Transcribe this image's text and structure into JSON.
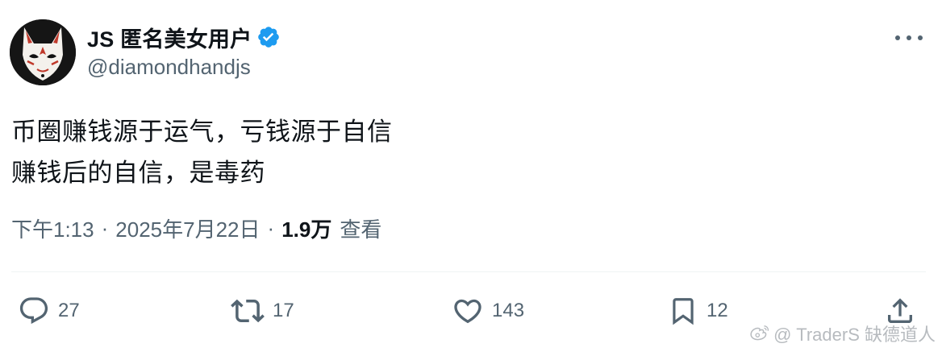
{
  "author": {
    "display_name": "JS 匿名美女用户",
    "handle": "@diamondhandjs",
    "verified_icon": "verified-badge-icon",
    "verified_color": "#1d9bf0",
    "avatar": "fox-mask-avatar"
  },
  "tweet": {
    "lines": [
      "币圈赚钱源于运气，亏钱源于自信",
      "赚钱后的自信，是毒药"
    ]
  },
  "meta": {
    "time": "下午1:13",
    "separator": "·",
    "date": "2025年7月22日",
    "views_count": "1.9万",
    "views_label": "查看"
  },
  "actions": {
    "reply": {
      "icon": "reply-icon",
      "count": "27"
    },
    "retweet": {
      "icon": "retweet-icon",
      "count": "17"
    },
    "like": {
      "icon": "heart-icon",
      "count": "143"
    },
    "bookmark": {
      "icon": "bookmark-icon",
      "count": "12"
    },
    "share": {
      "icon": "share-icon"
    }
  },
  "more_icon": "more-options-icon",
  "watermark": {
    "text": "@ TraderS 缺德道人"
  },
  "colors": {
    "text": "#0f1419",
    "secondary": "#536471",
    "divider": "#eff3f4",
    "accent": "#1d9bf0"
  }
}
